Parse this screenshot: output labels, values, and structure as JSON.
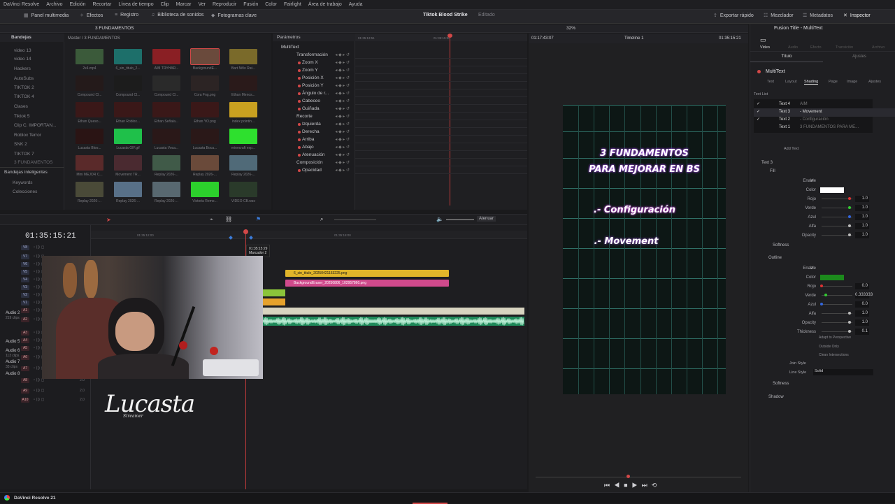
{
  "menu": [
    "DaVinci Resolve",
    "Archivo",
    "Edición",
    "Recortar",
    "Línea de tiempo",
    "Clip",
    "Marcar",
    "Ver",
    "Reproducir",
    "Fusión",
    "Color",
    "Fairlight",
    "Área de trabajo",
    "Ayuda"
  ],
  "toolbar": {
    "media_pool": "Panel multimedia",
    "effects": "Efectos",
    "index": "Registro",
    "sound_library": "Biblioteca de sonidos",
    "keyframes": "Fotogramas clave",
    "project_title": "Tiktok Blood Strike",
    "project_status": "Editado",
    "quick_export": "Exportar rápido",
    "mixer": "Mezclador",
    "metadata": "Metadatos",
    "inspector": "Inspector"
  },
  "bins": {
    "header": "Bandejas",
    "breadcrumb": "Master / 3 FUNDAMENTOS",
    "folder": "3 FUNDAMENTOS",
    "items": [
      "video 13",
      "video 14",
      "Hackers",
      "AutoSubs",
      "TIKTOK 2",
      "TIKTOK 4",
      "Clases",
      "Tiktok 5",
      "Clip C. IMPORTAN...",
      "Roblox Terror",
      "SNK 2",
      "TIKTOK 7",
      "3 FUNDAMENTOS"
    ],
    "smart_bins": "Bandejas inteligentes",
    "smart_items": [
      "Keywords",
      "Colecciones"
    ]
  },
  "media": {
    "clips": [
      "2x4.mp4",
      "6_sin_titulo_2...",
      "AIM TRYHAR...",
      "BackgroundE...",
      "Bart Niño Rat...",
      "Compound Cl...",
      "Compound Cl...",
      "Compound Cl...",
      "Cora Fng.png",
      "Ethan Menos...",
      "Ethan Queso...",
      "Ethan Roblox...",
      "Ethan Señala...",
      "Ethan YO.png",
      "index pointin...",
      "Lucasta Bloo...",
      "Lucasta GIF.gif",
      "Lucasta Voca...",
      "Lucasta Boca...",
      "minecraft exp...",
      "Mini MEJOR C...",
      "Movement TR...",
      "Replay 2026-...",
      "Replay 2026-...",
      "Replay 2026-...",
      "Replay 2026-...",
      "Replay 2026-...",
      "Replay 2026-...",
      "Victoria Remo...",
      "VIDEO CB.wav"
    ]
  },
  "params": {
    "header": "Parámetros",
    "title": "MultiText",
    "rows": [
      "Transformación",
      "Zoom X",
      "Zoom Y",
      "Posición X",
      "Posición Y",
      "Ángulo de r...",
      "Cabeceo",
      "Guiñada",
      "Recorte",
      "Izquierda",
      "Derecha",
      "Arriba",
      "Abajo",
      "Atenuación",
      "Composición",
      "Opacidad"
    ],
    "t1": "01:35:13:51",
    "t2": "01:35:15:00"
  },
  "timeline": {
    "timecode": "01:35:15:21",
    "ruler1": "01:35:12:00",
    "ruler2": "01:35:18:00",
    "marker_time": "01:35:15:29",
    "marker_label": "Marcador 2",
    "mute_label": "Atenuar",
    "clip1": "6_sin_titulo_20250421153225.png",
    "clip2": "BackgroundEraser_20250806_102957860.png"
  },
  "tracks": [
    {
      "id": "V8"
    },
    {
      "id": "V7"
    },
    {
      "id": "V6"
    },
    {
      "id": "V5"
    },
    {
      "id": "V4"
    },
    {
      "id": "V3"
    },
    {
      "id": "V2"
    },
    {
      "id": "V1"
    },
    {
      "id": "A1"
    },
    {
      "id": "A2",
      "name": "Audio 2",
      "clips": "219 clips"
    },
    {
      "id": "A3"
    },
    {
      "id": "A4"
    },
    {
      "id": "A5",
      "name": "Audio 5"
    },
    {
      "id": "A6",
      "name": "Audio 6",
      "clips": "113 clips",
      "vol": "2.0"
    },
    {
      "id": "A7",
      "name": "Audio 7",
      "clips": "33 clips",
      "vol": "2.0"
    },
    {
      "id": "A8",
      "name": "Audio 8",
      "vol": "2.0"
    },
    {
      "id": "A9",
      "vol": "2.0"
    },
    {
      "id": "A10",
      "vol": "2.0"
    }
  ],
  "watermark": "Lucasta",
  "watermark_sub": "Streamer",
  "viewer": {
    "zoom": "32%",
    "timecode_left": "01:17:43:07",
    "timeline_name": "Timeline 1",
    "timecode_right": "01:35:15:21"
  },
  "video_text": {
    "line1": "3 FUNDAMENTOS",
    "line2": "PARA MEJORAR EN BS",
    "line3": ".- Configuración",
    "line4": ".- Movement"
  },
  "inspector": {
    "title": "Fusion Title - MultiText",
    "tabs": [
      "Video",
      "Audio",
      "Efecto",
      "Transición",
      "Archivo"
    ],
    "subtabs": [
      "Título",
      "Ajustes"
    ],
    "node": "MultiText",
    "sections": [
      "Text",
      "Layout",
      "Shading",
      "Page",
      "Image",
      "Ajustes"
    ],
    "text_list_label": "Text List",
    "texts": [
      {
        "name": "Text 4",
        "value": "AIM"
      },
      {
        "name": "Text 3",
        "value": "- Movement"
      },
      {
        "name": "Text 2",
        "value": "- Configuración"
      },
      {
        "name": "Text 1",
        "value": "3 FUNDAMENTOS PARA ME..."
      }
    ],
    "add_text": "Add Text",
    "text3": "Text 3",
    "fill": "Fill",
    "enable": "Enable",
    "color": "Color",
    "rojo": "Rojo",
    "verde": "Verde",
    "azul": "Azul",
    "alfa": "Alfa",
    "opacity": "Opacity",
    "softness": "Softness",
    "outline": "Outline",
    "thickness": "Thickness",
    "adapt": "Adapt to Perspective",
    "outside_only": "Outside Only",
    "clean": "Clean Intersections",
    "join_style": "Join Style",
    "line_style": "Line Style",
    "line_style_value": "Solid",
    "shadow": "Shadow",
    "fill_values": [
      "1.0",
      "1.0",
      "1.0",
      "1.0",
      "1.0"
    ],
    "outline_values": [
      "0.0",
      "0.333333",
      "0.0",
      "1.0",
      "1.0",
      "0.1"
    ],
    "fill_color": "#ffffff",
    "outline_color": "#1c8a1c"
  },
  "status": {
    "app": "DaVinci Resolve 21"
  }
}
